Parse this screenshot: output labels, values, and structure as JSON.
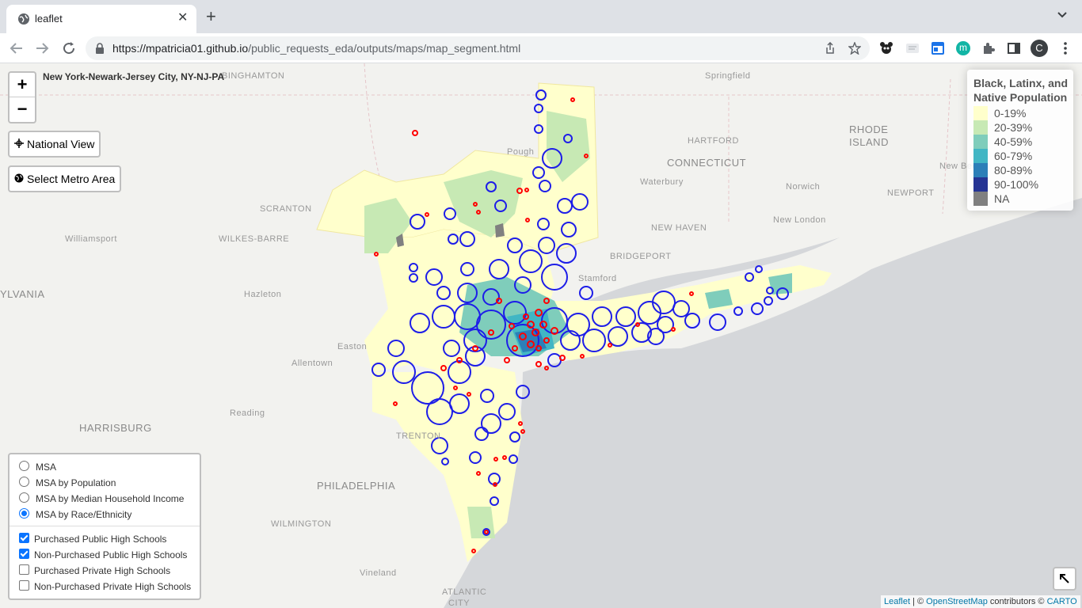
{
  "browser": {
    "tab_title": "leaflet",
    "new_tab": "+",
    "close_tab": "✕",
    "url_domain": "https://mpatricia01.github.io",
    "url_path": "/public_requests_eda/outputs/maps/map_segment.html",
    "profile_initial": "C",
    "ext_m_label": "m"
  },
  "map": {
    "metro_title": "New York-Newark-Jersey City, NY-NJ-PA",
    "zoom_in": "+",
    "zoom_out": "−",
    "national_view": "National View",
    "select_metro": "Select Metro Area",
    "legend": {
      "title": "Black, Latinx, and Native Population",
      "items": [
        {
          "label": "0-19%",
          "color": "#ffffcc"
        },
        {
          "label": "20-39%",
          "color": "#c7e9b4"
        },
        {
          "label": "40-59%",
          "color": "#7fcdbb"
        },
        {
          "label": "60-79%",
          "color": "#41b6c4"
        },
        {
          "label": "80-89%",
          "color": "#2c7fb8"
        },
        {
          "label": "90-100%",
          "color": "#253494"
        },
        {
          "label": "NA",
          "color": "#808080"
        }
      ]
    },
    "layers": {
      "base": [
        {
          "label": "MSA",
          "selected": false
        },
        {
          "label": "MSA by Population",
          "selected": false
        },
        {
          "label": "MSA by Median Household Income",
          "selected": false
        },
        {
          "label": "MSA by Race/Ethnicity",
          "selected": true
        }
      ],
      "overlays": [
        {
          "label": "Purchased Public High Schools",
          "checked": true
        },
        {
          "label": "Non-Purchased Public High Schools",
          "checked": true
        },
        {
          "label": "Purchased Private High Schools",
          "checked": false
        },
        {
          "label": "Non-Purchased Private High Schools",
          "checked": false
        }
      ]
    },
    "attribution": {
      "leaflet": "Leaflet",
      "sep": " | © ",
      "osm": "OpenStreetMap",
      "contrib": " contributors © ",
      "carto": "CARTO"
    },
    "places": [
      "BINGHAMTON",
      "Springfield",
      "RHODE",
      "ISLAND",
      "HARTFORD",
      "CONNECTICUT",
      "Waterbury",
      "Norwich",
      "New Bed",
      "NEWPORT",
      "New London",
      "NEW HAVEN",
      "BRIDGEPORT",
      "Stamford",
      "SCRANTON",
      "WILKES-BARRE",
      "Williamsport",
      "Hazleton",
      "YLVANIA",
      "Easton",
      "Allentown",
      "Reading",
      "HARRISBURG",
      "TRENTON",
      "PHILADELPHIA",
      "WILMINGTON",
      "Vineland",
      "ATLANTIC",
      "CITY",
      "Pough"
    ]
  }
}
